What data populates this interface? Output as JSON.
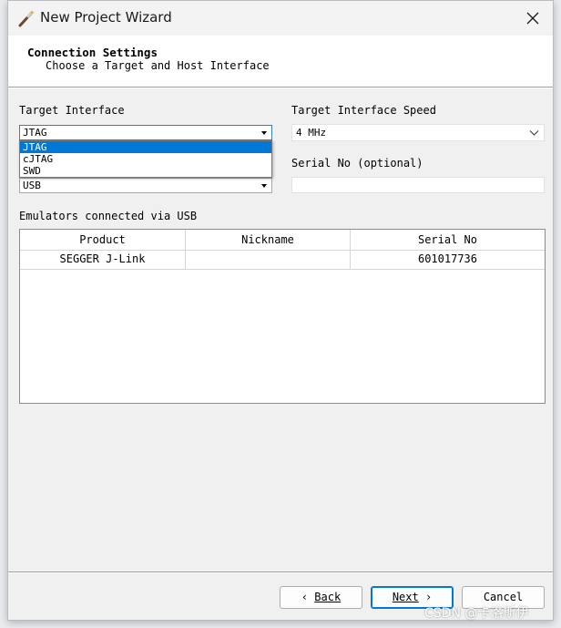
{
  "window": {
    "title": "New Project Wizard"
  },
  "header": {
    "title": "Connection Settings",
    "subtitle": "Choose a Target and Host Interface"
  },
  "target_interface": {
    "label": "Target Interface",
    "value": "JTAG",
    "options": [
      "JTAG",
      "cJTAG",
      "SWD"
    ],
    "selected_index": 0
  },
  "host_interface": {
    "value": "USB"
  },
  "speed": {
    "label": "Target Interface Speed",
    "value": "4 MHz"
  },
  "serial": {
    "label": "Serial No (optional)",
    "value": ""
  },
  "emulators": {
    "label": "Emulators connected via USB",
    "columns": [
      "Product",
      "Nickname",
      "Serial No"
    ],
    "rows": [
      {
        "product": "SEGGER J-Link",
        "nickname": "",
        "serial": "601017736"
      }
    ]
  },
  "buttons": {
    "back": "Back",
    "next": "Next",
    "cancel": "Cancel"
  },
  "watermark": "CSDN @卡洛斯伊",
  "colors": {
    "selection": "#0078d7",
    "focus_border": "#3c7fb1",
    "header_bg": "#ffffff",
    "dialog_bg": "#f0f0f0"
  }
}
